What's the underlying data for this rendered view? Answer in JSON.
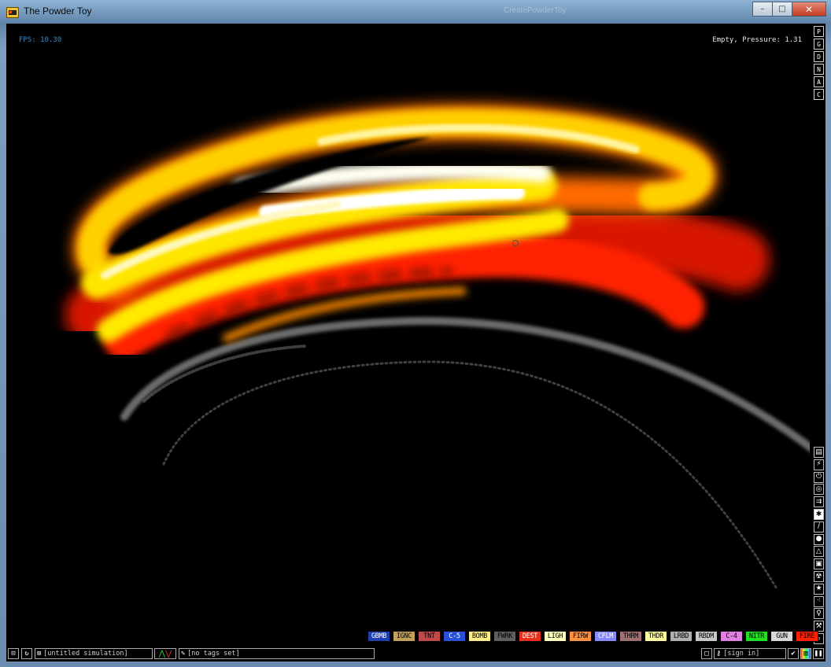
{
  "window": {
    "title": "The Powder Toy",
    "ghost_title": "CreatePowderToy",
    "controls": {
      "minimize": "–",
      "maximize": "□",
      "close": "✕"
    }
  },
  "hud": {
    "fps": "FPS: 10.30",
    "status": "Empty, Pressure: 1.31"
  },
  "display_modes": [
    "P",
    "G",
    "D",
    "N",
    "A",
    "C"
  ],
  "categories": [
    {
      "icon": "keyboard-icon",
      "glyph": "▤"
    },
    {
      "icon": "electronics-icon",
      "glyph": "⚡"
    },
    {
      "icon": "powered-icon",
      "glyph": "⏻"
    },
    {
      "icon": "sensors-icon",
      "glyph": "◎"
    },
    {
      "icon": "force-icon",
      "glyph": "⇉"
    },
    {
      "icon": "explosives-icon",
      "glyph": "✱",
      "active": true
    },
    {
      "icon": "solids-icon",
      "glyph": "/"
    },
    {
      "icon": "liquids-icon",
      "glyph": "●"
    },
    {
      "icon": "gases-icon",
      "glyph": "△"
    },
    {
      "icon": "powders-icon",
      "glyph": "▣"
    },
    {
      "icon": "radioactive-icon",
      "glyph": "☢"
    },
    {
      "icon": "special-icon",
      "glyph": "★"
    },
    {
      "icon": "particles-icon",
      "glyph": "⁖"
    },
    {
      "icon": "life-icon",
      "glyph": "♀"
    },
    {
      "icon": "tools-icon",
      "glyph": "⚒"
    },
    {
      "icon": "search-icon",
      "glyph": "⌕"
    }
  ],
  "elements": [
    {
      "label": "GBMB",
      "bg": "#1e3fb0",
      "fg": "#ffffff"
    },
    {
      "label": "IGNC",
      "bg": "#c0a05a",
      "fg": "#000000"
    },
    {
      "label": "TNT",
      "bg": "#c04848",
      "fg": "#000000"
    },
    {
      "label": "C-5",
      "bg": "#2a50d8",
      "fg": "#ffffff"
    },
    {
      "label": "BOMB",
      "bg": "#ffee88",
      "fg": "#000000"
    },
    {
      "label": "FWRK",
      "bg": "#606060",
      "fg": "#000000"
    },
    {
      "label": "DEST",
      "bg": "#e8301c",
      "fg": "#ffffff"
    },
    {
      "label": "LIGH",
      "bg": "#ffffc0",
      "fg": "#000000"
    },
    {
      "label": "FIRW",
      "bg": "#ff9040",
      "fg": "#000000"
    },
    {
      "label": "CFLM",
      "bg": "#8888ff",
      "fg": "#ffffff"
    },
    {
      "label": "THRM",
      "bg": "#a07070",
      "fg": "#000000"
    },
    {
      "label": "THDR",
      "bg": "#ffffa0",
      "fg": "#000000"
    },
    {
      "label": "LRBD",
      "bg": "#b0b0b0",
      "fg": "#000000"
    },
    {
      "label": "RBDM",
      "bg": "#c8c8c8",
      "fg": "#000000"
    },
    {
      "label": "C-4",
      "bg": "#e080e0",
      "fg": "#000000"
    },
    {
      "label": "NITR",
      "bg": "#20e020",
      "fg": "#000000"
    },
    {
      "label": "GUN",
      "bg": "#d8d8d8",
      "fg": "#000000"
    },
    {
      "label": "FIRE",
      "bg": "#ff2000",
      "fg": "#000000"
    }
  ],
  "bottom": {
    "open_icon": "⊡",
    "reload_icon": "↻",
    "save_icon": "⊞",
    "save_name": "[untitled simulation]",
    "vote_up": "⋀",
    "vote_down": "⋁",
    "tags_icon": "✎",
    "tags": "[no tags set]",
    "new_icon": "□",
    "login_icon": "⚷",
    "login_label": "[sign in]",
    "settings_icon": "✔",
    "renderer_icon": "▥",
    "pause_icon": "❚❚"
  }
}
